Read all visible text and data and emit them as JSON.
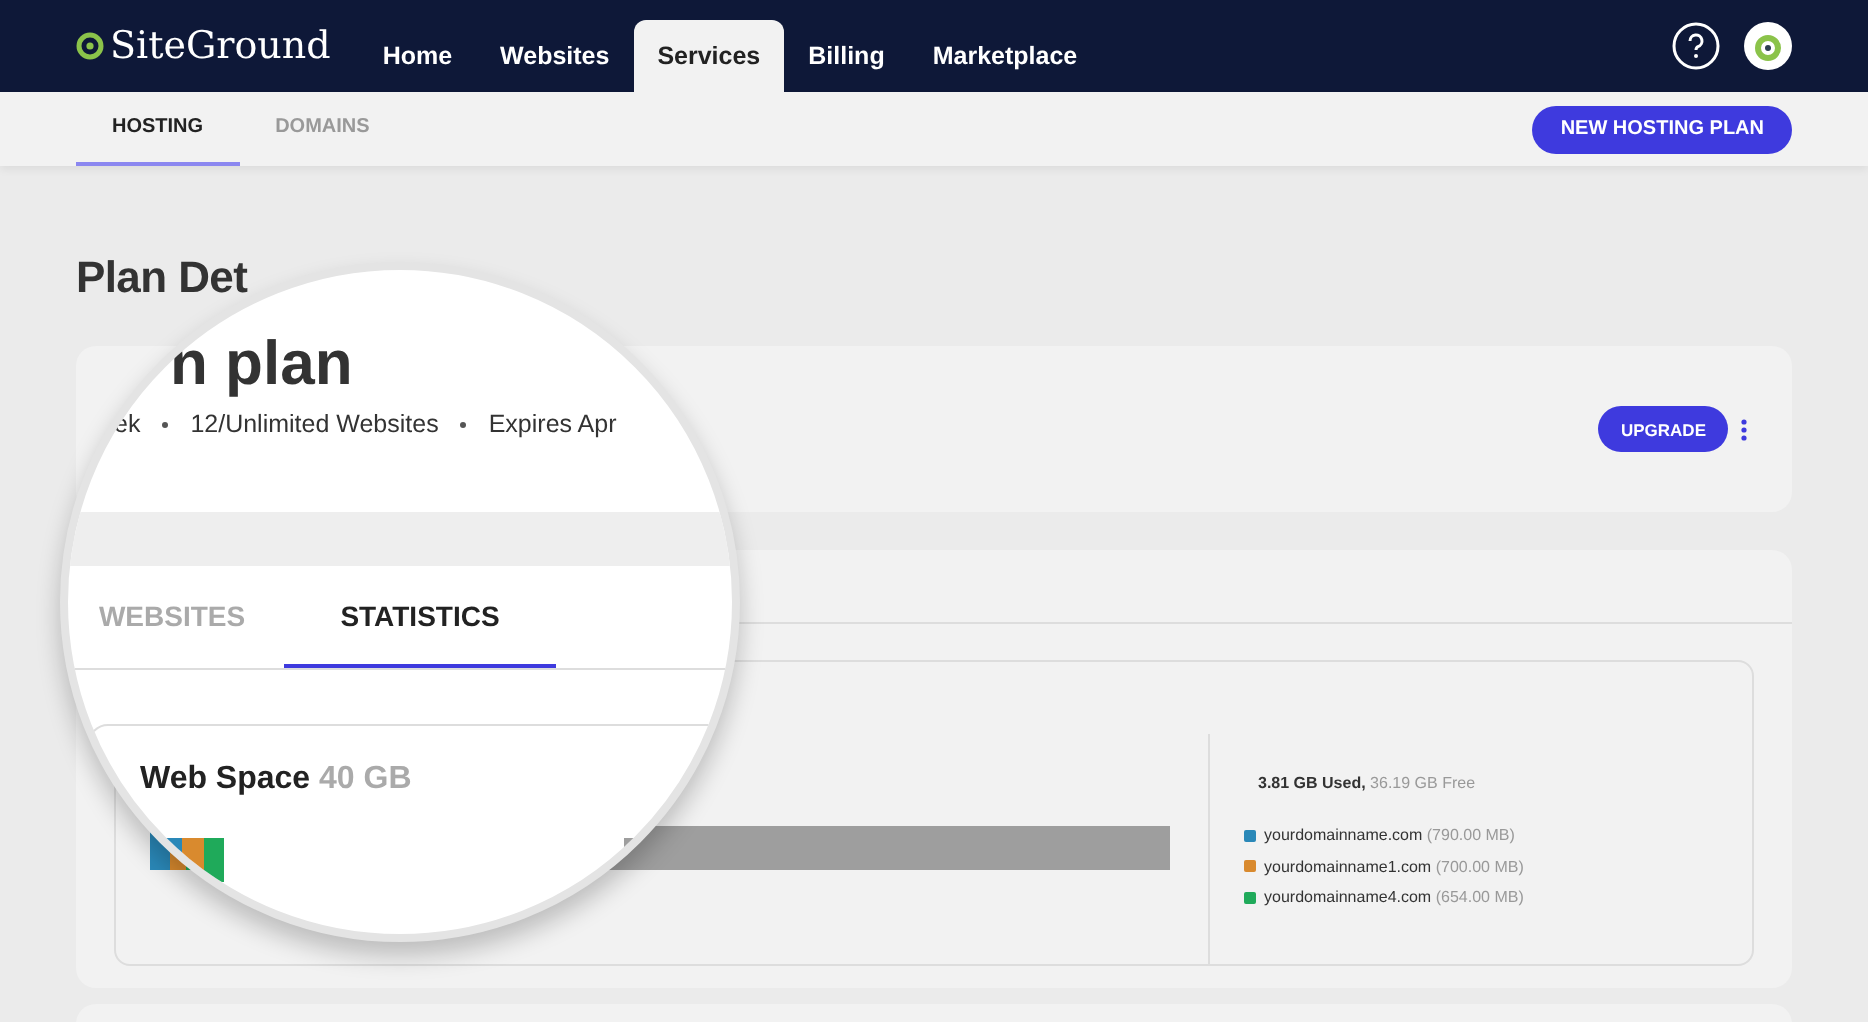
{
  "header": {
    "logo": "SiteGround",
    "nav": [
      {
        "label": "Home",
        "selected": false
      },
      {
        "label": "Websites",
        "selected": false
      },
      {
        "label": "Services",
        "selected": true
      },
      {
        "label": "Billing",
        "selected": false
      },
      {
        "label": "Marketplace",
        "selected": false
      }
    ]
  },
  "subnav": {
    "tabs": [
      {
        "label": "HOSTING",
        "selected": true
      },
      {
        "label": "DOMAINS",
        "selected": false
      }
    ],
    "button": "NEW HOSTING PLAN"
  },
  "page_title": "Plan Det",
  "plan_card": {
    "button": "UPGRADE"
  },
  "magnifier": {
    "plan_name": "n plan",
    "meta": [
      "ek",
      "12/Unlimited Websites",
      "Expires Apr"
    ],
    "tabs": [
      {
        "label": "WEBSITES",
        "selected": false
      },
      {
        "label": "STATISTICS",
        "selected": true
      }
    ],
    "title": "Web Space",
    "quota": "40 GB"
  },
  "usage_bar": {
    "segments": [
      {
        "color": "#2a88b8",
        "level": 0.019
      },
      {
        "color": "#d98a2e",
        "level": 0.017
      },
      {
        "color": "#1faa5a",
        "level": 0.016
      }
    ]
  },
  "web_space": {
    "used": "3.81 GB Used,",
    "free": "36.19 GB Free",
    "domains": [
      {
        "name": "yourdomainname.com",
        "size": "(790.00 MB)",
        "color": "#2a88b8"
      },
      {
        "name": "yourdomainname1.com",
        "size": "(700.00 MB)",
        "color": "#d98a2e"
      },
      {
        "name": "yourdomainname4.com",
        "size": "(654.00 MB)",
        "color": "#1faa5a"
      }
    ]
  }
}
